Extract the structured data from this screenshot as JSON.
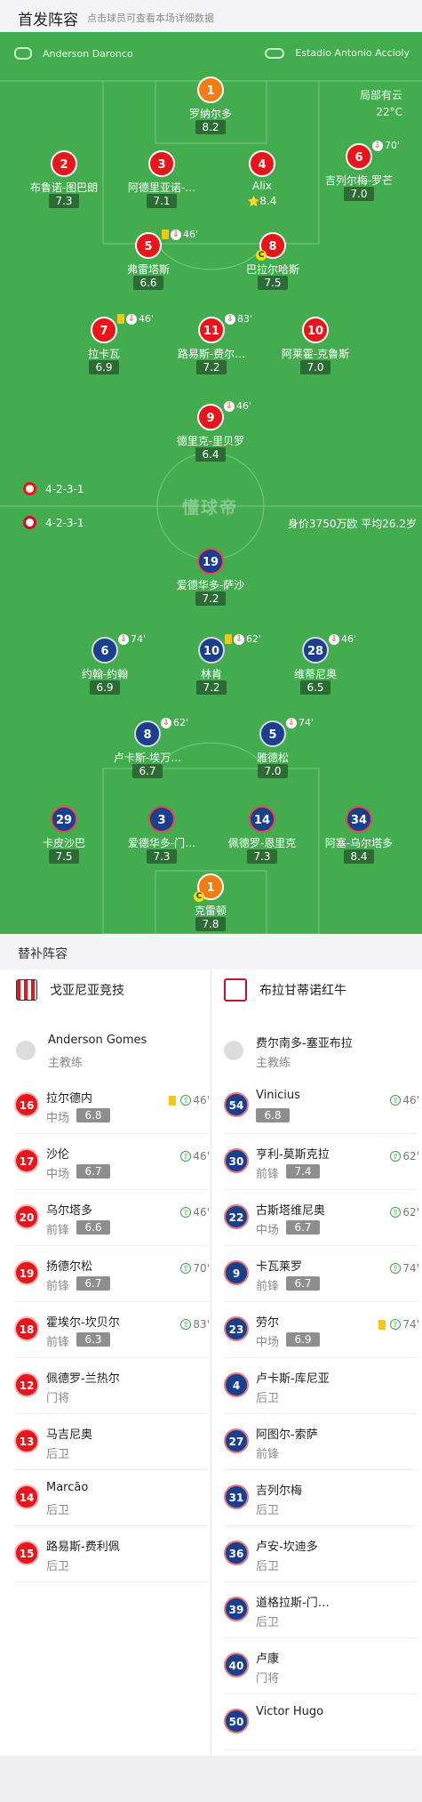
{
  "header": {
    "title": "首发阵容",
    "hint": "点击球员可查看本场详细数据"
  },
  "match": {
    "referee": "Anderson Daronco",
    "venue": "Estadio Antonio Accioly",
    "weather": "局部有云",
    "temperature": "22°C",
    "watermark": "懂球帝"
  },
  "home": {
    "name": "戈亚尼亚竞技",
    "formation": "4-2-3-1",
    "colors": {
      "primary": "#e8161b",
      "gk": "#f47a12"
    },
    "coach": {
      "name": "Anderson Gomes",
      "role": "主教练"
    },
    "starters": [
      {
        "number": "1",
        "name": "罗纳尔多",
        "rating": "8.2",
        "events": []
      },
      {
        "number": "2",
        "name": "布鲁诺-图巴朗",
        "rating": "7.3",
        "events": []
      },
      {
        "number": "3",
        "name": "阿德里亚诺-…",
        "rating": "7.1",
        "events": []
      },
      {
        "number": "4",
        "name": "Alix",
        "rating": "8.4",
        "star": true,
        "events": []
      },
      {
        "number": "6",
        "name": "吉列尔梅-罗芒",
        "rating": "7.0",
        "events": [
          "sub-out"
        ],
        "minute": "70'"
      },
      {
        "number": "5",
        "name": "弗雷塔斯",
        "rating": "6.6",
        "events": [
          "yellow",
          "sub-out"
        ],
        "minute": "46'"
      },
      {
        "number": "8",
        "name": "巴拉尔哈斯",
        "rating": "7.5",
        "captain": true,
        "events": []
      },
      {
        "number": "7",
        "name": "拉卡瓦",
        "rating": "6.9",
        "events": [
          "yellow",
          "sub-out"
        ],
        "minute": "46'"
      },
      {
        "number": "11",
        "name": "路易斯-费尔…",
        "rating": "7.2",
        "events": [
          "sub-out"
        ],
        "minute": "83'"
      },
      {
        "number": "10",
        "name": "阿莱霍-克鲁斯",
        "rating": "7.0",
        "events": []
      },
      {
        "number": "9",
        "name": "德里克-里贝罗",
        "rating": "6.4",
        "events": [
          "sub-out"
        ],
        "minute": "46'"
      }
    ],
    "bench": [
      {
        "number": "16",
        "name": "拉尔德内",
        "position": "中场",
        "rating": "6.8",
        "yellow": true,
        "sub_minute": "46'"
      },
      {
        "number": "17",
        "name": "沙伦",
        "position": "中场",
        "rating": "6.7",
        "sub_minute": "46'"
      },
      {
        "number": "20",
        "name": "乌尔塔多",
        "position": "前锋",
        "rating": "6.6",
        "sub_minute": "46'"
      },
      {
        "number": "19",
        "name": "扬德尔松",
        "position": "前锋",
        "rating": "6.7",
        "sub_minute": "70'"
      },
      {
        "number": "18",
        "name": "霍埃尔-坎贝尔",
        "position": "前锋",
        "rating": "6.3",
        "sub_minute": "83'"
      },
      {
        "number": "12",
        "name": "佩德罗-兰热尔",
        "position": "门将"
      },
      {
        "number": "13",
        "name": "马吉尼奥",
        "position": "后卫"
      },
      {
        "number": "14",
        "name": "Marcão",
        "position": "后卫"
      },
      {
        "number": "15",
        "name": "路易斯-费利佩",
        "position": "后卫"
      }
    ]
  },
  "away": {
    "name": "布拉甘蒂诺红牛",
    "formation": "4-2-3-1",
    "value_info": "身价3750万欧 平均26.2岁",
    "colors": {
      "primary": "#1b3f8f"
    },
    "coach": {
      "name": "费尔南多-塞亚布拉",
      "role": "主教练"
    },
    "starters": [
      {
        "number": "19",
        "name": "爱德华多-萨沙",
        "rating": "7.2",
        "events": []
      },
      {
        "number": "6",
        "name": "约翰-约翰",
        "rating": "6.9",
        "events": [
          "sub-out"
        ],
        "minute": "74'"
      },
      {
        "number": "10",
        "name": "林肯",
        "rating": "7.2",
        "events": [
          "yellow",
          "sub-out"
        ],
        "minute": "62'"
      },
      {
        "number": "28",
        "name": "维蒂尼奥",
        "rating": "6.5",
        "events": [
          "sub-out"
        ],
        "minute": "46'"
      },
      {
        "number": "8",
        "name": "卢卡斯-埃万…",
        "rating": "6.7",
        "events": [
          "sub-out"
        ],
        "minute": "62'"
      },
      {
        "number": "5",
        "name": "雅德松",
        "rating": "7.0",
        "events": [
          "sub-out"
        ],
        "minute": "74'"
      },
      {
        "number": "29",
        "name": "卡皮沙巴",
        "rating": "7.5",
        "events": []
      },
      {
        "number": "3",
        "name": "爱德华多-门…",
        "rating": "7.3",
        "events": []
      },
      {
        "number": "14",
        "name": "佩德罗-恩里克",
        "rating": "7.3",
        "events": []
      },
      {
        "number": "34",
        "name": "阿塞-乌尔塔多",
        "rating": "8.4",
        "events": []
      },
      {
        "number": "1",
        "name": "克雷顿",
        "rating": "7.8",
        "captain": true,
        "events": []
      }
    ],
    "bench": [
      {
        "number": "54",
        "name": "Vinicius",
        "position": "",
        "rating": "6.8",
        "sub_minute": "46'"
      },
      {
        "number": "30",
        "name": "亨利-莫斯克拉",
        "position": "前锋",
        "rating": "7.4",
        "sub_minute": "62'"
      },
      {
        "number": "22",
        "name": "古斯塔维尼奥",
        "position": "中场",
        "rating": "6.7",
        "sub_minute": "62'"
      },
      {
        "number": "9",
        "name": "卡瓦莱罗",
        "position": "前锋",
        "rating": "6.7",
        "sub_minute": "74'"
      },
      {
        "number": "23",
        "name": "劳尔",
        "position": "中场",
        "rating": "6.9",
        "yellow": true,
        "sub_minute": "74'"
      },
      {
        "number": "4",
        "name": "卢卡斯-库尼亚",
        "position": "后卫"
      },
      {
        "number": "27",
        "name": "阿图尔-索萨",
        "position": "前锋"
      },
      {
        "number": "31",
        "name": "吉列尔梅",
        "position": "后卫"
      },
      {
        "number": "36",
        "name": "卢安-坎迪多",
        "position": "后卫"
      },
      {
        "number": "39",
        "name": "道格拉斯-门…",
        "position": "后卫"
      },
      {
        "number": "40",
        "name": "卢康",
        "position": "门将"
      },
      {
        "number": "50",
        "name": "Victor Hugo",
        "position": ""
      }
    ]
  },
  "subs_section_title": "替补阵容"
}
